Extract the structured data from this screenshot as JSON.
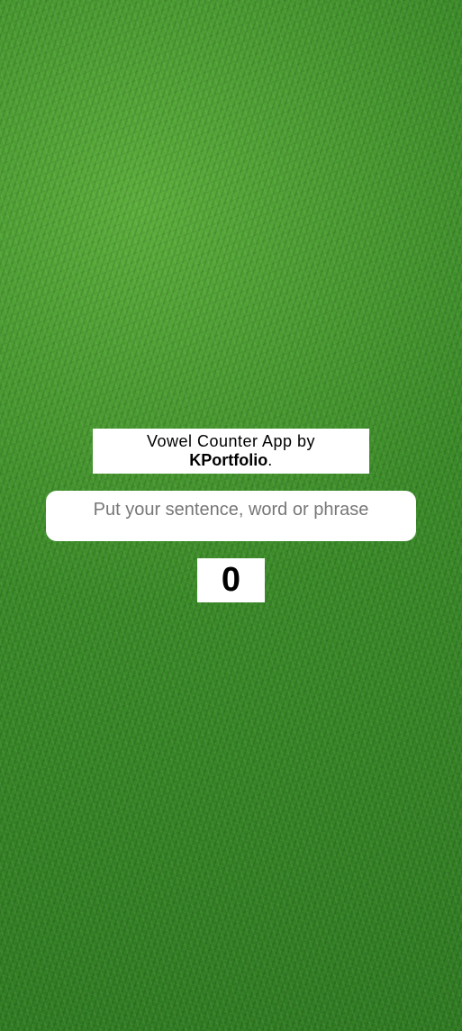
{
  "header": {
    "title_prefix": "Vowel Counter App by",
    "brand": "KPortfolio",
    "title_suffix": "."
  },
  "input": {
    "placeholder": "Put your sentence, word or phrase",
    "value": ""
  },
  "result": {
    "vowel_count": "0"
  },
  "colors": {
    "background": "#3f8f2c",
    "panel": "#ffffff",
    "text": "#000000"
  }
}
